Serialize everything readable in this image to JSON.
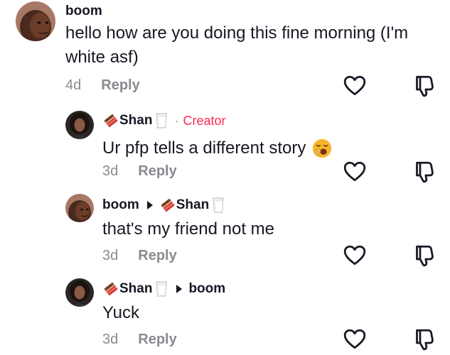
{
  "comments": [
    {
      "username": "boom",
      "text": "hello how are you doing this fine morning (I'm white asf)",
      "time": "4d",
      "reply_label": "Reply"
    },
    {
      "username": "Shan",
      "creator_separator": "·",
      "creator_label": "Creator",
      "text": "Ur pfp tells a different story",
      "time": "3d",
      "reply_label": "Reply"
    },
    {
      "username": "boom",
      "reply_to": "Shan",
      "text": "that's my friend not me",
      "time": "3d",
      "reply_label": "Reply"
    },
    {
      "username": "Shan",
      "reply_to": "boom",
      "text": "Yuck",
      "time": "3d",
      "reply_label": "Reply"
    }
  ],
  "icons": {
    "like": "heart-icon",
    "dislike": "thumbs-down-icon",
    "username_prefix": "chocolate-bar-emoji",
    "username_suffix": "milk-glass-emoji",
    "reaction": "yawning-face-emoji"
  },
  "colors": {
    "text": "#161823",
    "secondary": "#8a8b91",
    "creator": "#fe2c55"
  }
}
